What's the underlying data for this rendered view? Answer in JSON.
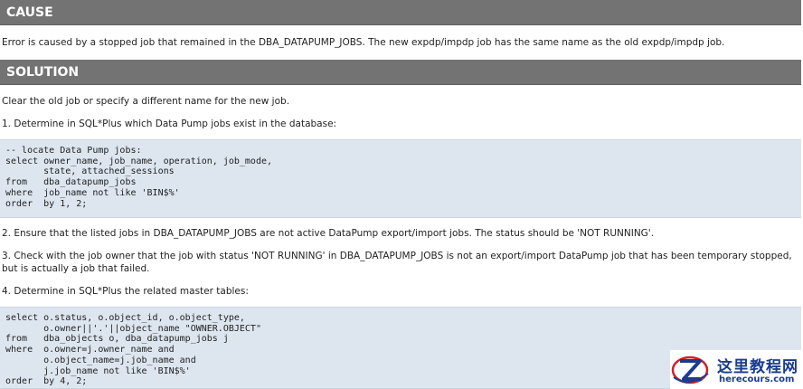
{
  "cause": {
    "heading": "CAUSE",
    "text": "Error is caused by a stopped job that remained in the DBA_DATAPUMP_JOBS. The new expdp/impdp job has the same name as the old expdp/impdp job."
  },
  "solution": {
    "heading": "SOLUTION",
    "intro": "Clear the old job or specify a different name for the new job.",
    "step1": "1. Determine in SQL*Plus which Data Pump jobs exist in the database:",
    "code1": "-- locate Data Pump jobs:\nselect owner_name, job_name, operation, job_mode,\n       state, attached_sessions\nfrom   dba_datapump_jobs\nwhere  job_name not like 'BIN$%'\norder  by 1, 2;",
    "step2": "2. Ensure that the listed jobs in DBA_DATAPUMP_JOBS are not active DataPump export/import jobs. The status should be 'NOT RUNNING'.",
    "step3": "3. Check with the job owner that the job with status 'NOT RUNNING' in DBA_DATAPUMP_JOBS is not an export/import DataPump job that has been temporary stopped, but is actually a job that failed.",
    "step4": "4. Determine in SQL*Plus the related master tables:",
    "code2": "select o.status, o.object_id, o.object_type,\n       o.owner||'.'||object_name \"OWNER.OBJECT\"\nfrom   dba_objects o, dba_datapump_jobs j\nwhere  o.owner=j.owner_name and\n       o.object_name=j.job_name and\n       j.job_name not like 'BIN$%'\norder  by 4, 2;"
  },
  "watermark": {
    "title": "这里教程网",
    "url": "herecours.com",
    "logo_icon": "stylized-z-swoosh-icon",
    "colors": {
      "blue": "#1b3c8c",
      "red": "#d0202a"
    }
  },
  "colors": {
    "header_bg": "#737373",
    "code_bg": "#dde6ef"
  }
}
